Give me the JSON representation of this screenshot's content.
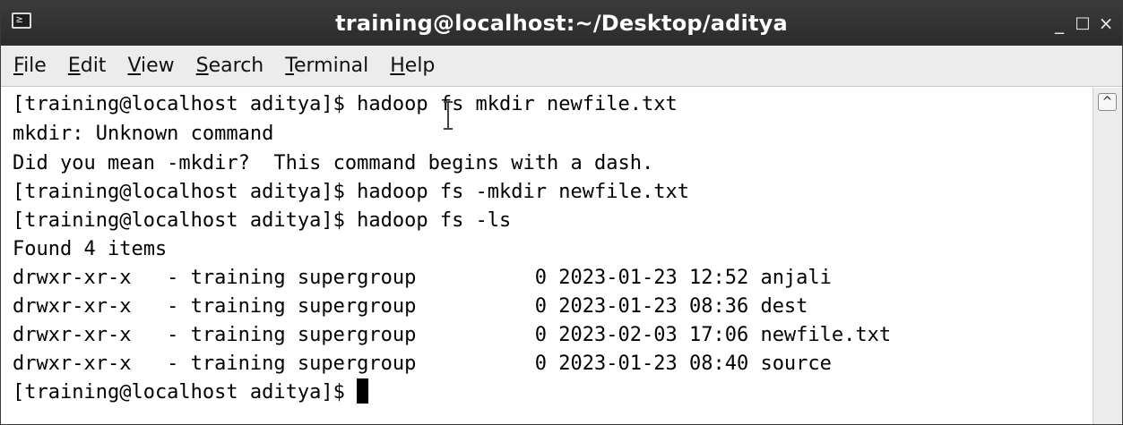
{
  "window": {
    "title": "training@localhost:~/Desktop/aditya",
    "app_icon_glyph": "≥",
    "minimize_glyph": "_",
    "maximize_glyph": "□",
    "close_glyph": "×"
  },
  "menu": [
    {
      "mnemonic": "F",
      "rest": "ile"
    },
    {
      "mnemonic": "E",
      "rest": "dit"
    },
    {
      "mnemonic": "V",
      "rest": "iew"
    },
    {
      "mnemonic": "S",
      "rest": "earch"
    },
    {
      "mnemonic": "T",
      "rest": "erminal"
    },
    {
      "mnemonic": "H",
      "rest": "elp"
    }
  ],
  "terminal": {
    "lines": [
      "[training@localhost aditya]$ hadoop fs mkdir newfile.txt",
      "mkdir: Unknown command",
      "Did you mean -mkdir?  This command begins with a dash.",
      "[training@localhost aditya]$ hadoop fs -mkdir newfile.txt",
      "[training@localhost aditya]$ hadoop fs -ls",
      "Found 4 items",
      "drwxr-xr-x   - training supergroup          0 2023-01-23 12:52 anjali",
      "drwxr-xr-x   - training supergroup          0 2023-01-23 08:36 dest",
      "drwxr-xr-x   - training supergroup          0 2023-02-03 17:06 newfile.txt",
      "drwxr-xr-x   - training supergroup          0 2023-01-23 08:40 source",
      "[training@localhost aditya]$ "
    ]
  },
  "scrollbar": {
    "up_arrow_glyph": "^"
  }
}
